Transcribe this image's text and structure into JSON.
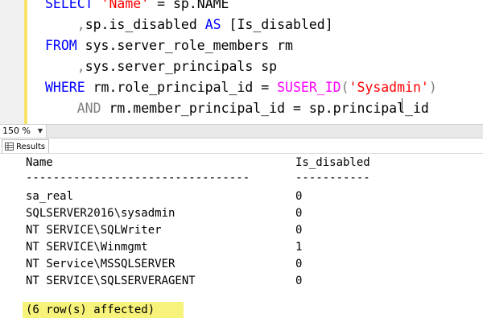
{
  "editor": {
    "lines": [
      {
        "kw1": "SELECT ",
        "str": "'Name'",
        "rest": " = sp.NAME"
      },
      {
        "indent": "    ",
        "gray": ",",
        "rest": "sp.is_disabled ",
        "kw": "AS",
        "rest2": " [Is_disabled]"
      },
      {
        "kw": "FROM",
        "rest": " sys.server_role_members rm"
      },
      {
        "indent": "    ",
        "gray": ",",
        "rest": "sys.server_principals sp"
      },
      {
        "kw": "WHERE",
        "rest": " rm.role_principal_id = ",
        "fn": "SUSER_ID",
        "paren1": "(",
        "str": "'Sysadmin'",
        "paren2": ")"
      },
      {
        "indent": "    ",
        "kw": "AND",
        "rest": " rm.member_principal_id = sp.principal_id"
      }
    ]
  },
  "statusbar": {
    "zoom": "150 %"
  },
  "tabs": {
    "results_label": "Results"
  },
  "results": {
    "headers": [
      "Name",
      "Is_disabled"
    ],
    "separator_name": "---------------------------------",
    "separator_val": "-----------",
    "rows": [
      {
        "name": "sa_real",
        "is_disabled": "0"
      },
      {
        "name": "SQLSERVER2016\\sysadmin",
        "is_disabled": "0"
      },
      {
        "name": "NT SERVICE\\SQLWriter",
        "is_disabled": "0"
      },
      {
        "name": "NT SERVICE\\Winmgmt",
        "is_disabled": "1"
      },
      {
        "name": "NT Service\\MSSQLSERVER",
        "is_disabled": "0"
      },
      {
        "name": "NT SERVICE\\SQLSERVERAGENT",
        "is_disabled": "0"
      }
    ],
    "affected": "(6 row(s) affected)"
  },
  "colors": {
    "keyword": "#0000ff",
    "string": "#ff0000",
    "function": "#ff00ff",
    "highlight": "#f7f27a"
  }
}
